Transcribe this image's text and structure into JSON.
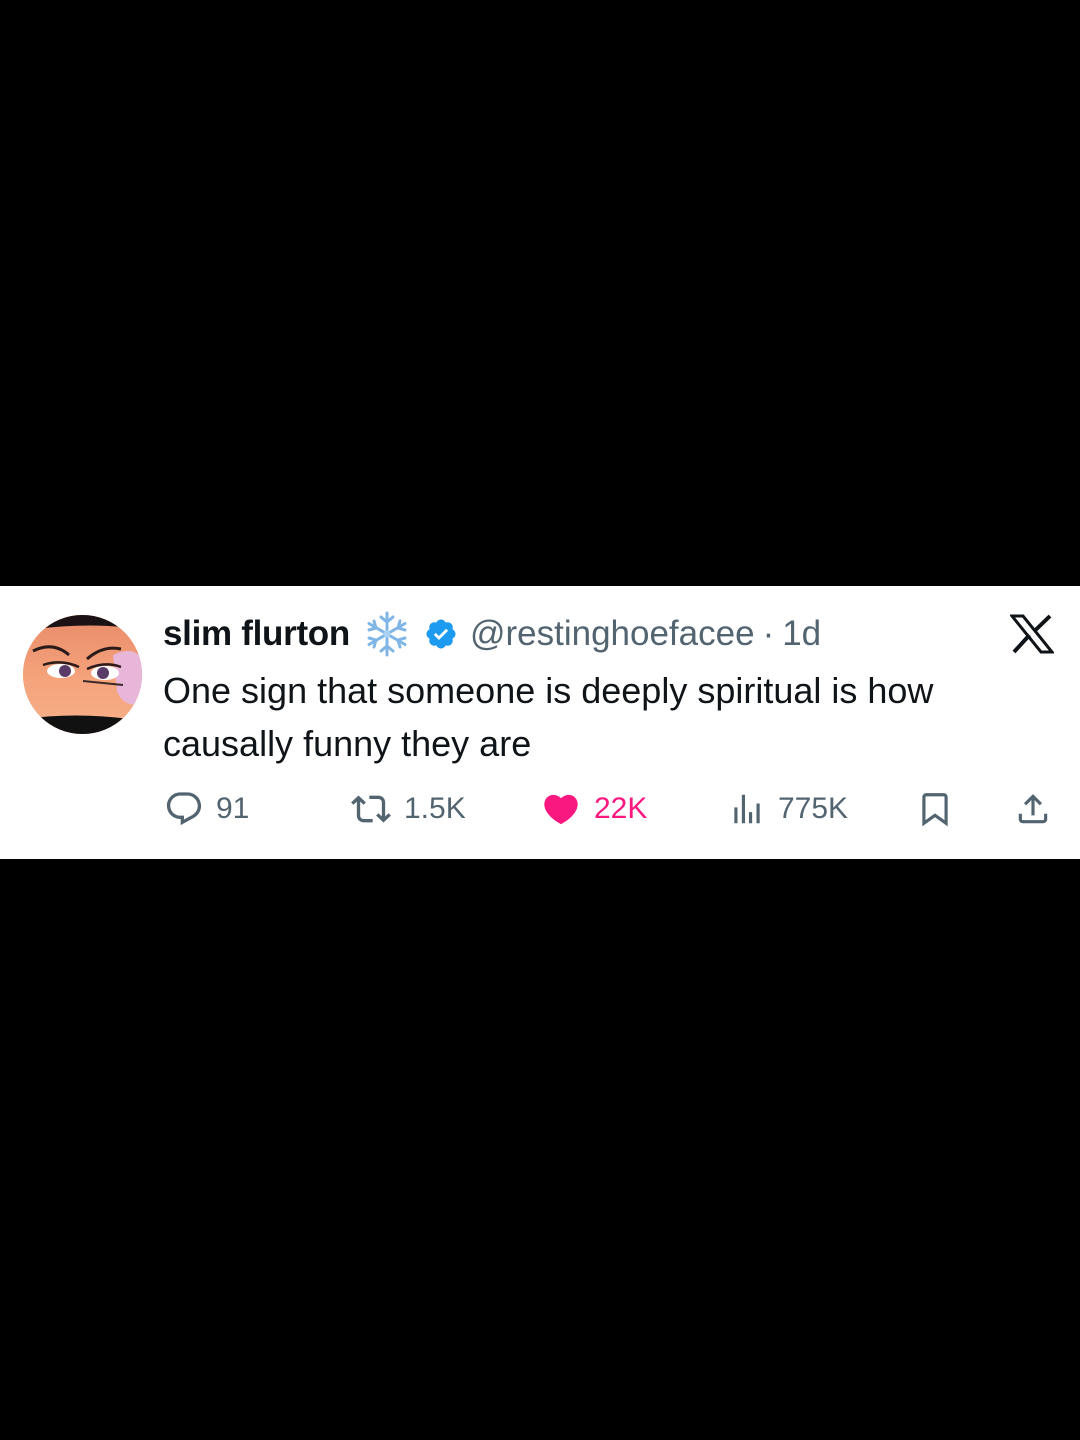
{
  "tweet": {
    "display_name": "slim flurton",
    "handle": "@restinghoefacee",
    "separator": "·",
    "time": "1d",
    "text": "One sign that someone is deeply spiritual is how causally funny they are",
    "emoji": "snowflake-icon",
    "verified": "verified-badge-icon",
    "platform_logo": "x-logo-icon"
  },
  "metrics": {
    "replies": "91",
    "reposts": "1.5K",
    "likes": "22K",
    "views": "775K"
  },
  "colors": {
    "background": "#000000",
    "card": "#ffffff",
    "text": "#0f1419",
    "secondary": "#536471",
    "like": "#f91880",
    "verified": "#1d9bf0"
  }
}
